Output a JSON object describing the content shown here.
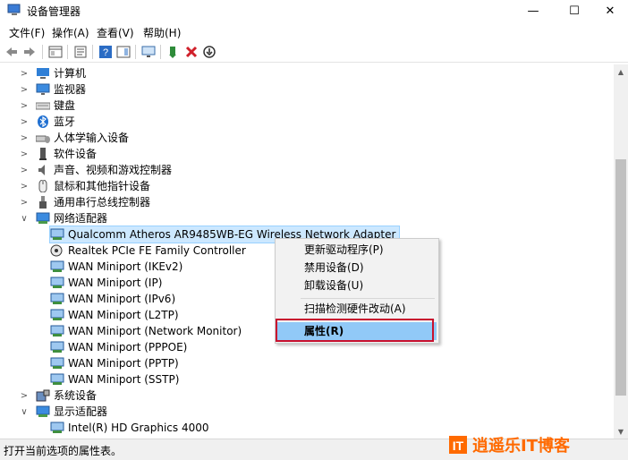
{
  "window": {
    "title": "设备管理器",
    "controls": {
      "minimize": "—",
      "maximize": "☐",
      "close": "✕"
    }
  },
  "menubar": [
    {
      "label": "文件(F)"
    },
    {
      "label": "操作(A)"
    },
    {
      "label": "查看(V)"
    },
    {
      "label": "帮助(H)"
    }
  ],
  "toolbar": {
    "icons": [
      "back-arrow-icon",
      "forward-arrow-icon",
      "show-hide-tree-icon",
      "properties-icon",
      "help-icon",
      "action-pane-icon",
      "monitor-scan-icon",
      "update-driver-icon",
      "uninstall-device-icon",
      "disable-device-icon"
    ]
  },
  "tree": {
    "categories": [
      {
        "label": "计算机",
        "expanded": false
      },
      {
        "label": "监视器",
        "expanded": false
      },
      {
        "label": "键盘",
        "expanded": false
      },
      {
        "label": "蓝牙",
        "expanded": false
      },
      {
        "label": "人体学输入设备",
        "expanded": false
      },
      {
        "label": "软件设备",
        "expanded": false
      },
      {
        "label": "声音、视频和游戏控制器",
        "expanded": false
      },
      {
        "label": "鼠标和其他指针设备",
        "expanded": false
      },
      {
        "label": "通用串行总线控制器",
        "expanded": false
      },
      {
        "label": "网络适配器",
        "expanded": true
      }
    ],
    "network_adapters": [
      {
        "label": "Qualcomm Atheros AR9485WB-EG Wireless Network Adapter",
        "selected": true
      },
      {
        "label": "Realtek PCIe FE Family Controller"
      },
      {
        "label": "WAN Miniport (IKEv2)"
      },
      {
        "label": "WAN Miniport (IP)"
      },
      {
        "label": "WAN Miniport (IPv6)"
      },
      {
        "label": "WAN Miniport (L2TP)"
      },
      {
        "label": "WAN Miniport (Network Monitor)"
      },
      {
        "label": "WAN Miniport (PPPOE)"
      },
      {
        "label": "WAN Miniport (PPTP)"
      },
      {
        "label": "WAN Miniport (SSTP)"
      }
    ],
    "after": [
      {
        "label": "系统设备",
        "expanded": false
      },
      {
        "label": "显示适配器",
        "expanded": true
      }
    ],
    "display_adapters": [
      {
        "label": "Intel(R) HD Graphics 4000"
      }
    ]
  },
  "context_menu": {
    "items": [
      {
        "label": "更新驱动程序(P)"
      },
      {
        "label": "禁用设备(D)"
      },
      {
        "label": "卸载设备(U)"
      },
      {
        "label": "扫描检测硬件改动(A)"
      },
      {
        "label": "属性(R)",
        "highlighted": true
      }
    ]
  },
  "statusbar": {
    "text": "打开当前选项的属性表。"
  },
  "watermark": {
    "text": "逍遥乐IT博客"
  },
  "colors": {
    "selection": "#cce8ff",
    "menu_highlight": "#91c9f7",
    "annotation_box": "#c8102e",
    "watermark": "#ff6a00"
  }
}
